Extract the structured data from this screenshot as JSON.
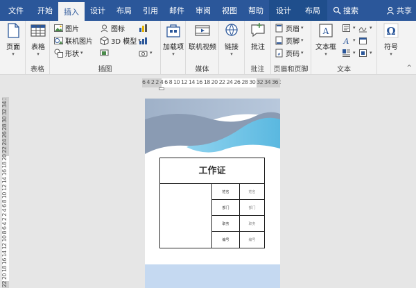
{
  "tabs": [
    {
      "label": "文件",
      "active": false
    },
    {
      "label": "开始",
      "active": false
    },
    {
      "label": "插入",
      "active": true
    },
    {
      "label": "设计",
      "active": false
    },
    {
      "label": "布局",
      "active": false
    },
    {
      "label": "引用",
      "active": false
    },
    {
      "label": "邮件",
      "active": false
    },
    {
      "label": "审阅",
      "active": false
    },
    {
      "label": "视图",
      "active": false
    },
    {
      "label": "帮助",
      "active": false
    },
    {
      "label": "设计",
      "active": false,
      "context": true
    },
    {
      "label": "布局",
      "active": false,
      "context": true
    }
  ],
  "search_label": "搜索",
  "share_label": "共享",
  "ribbon": {
    "page": {
      "button": "页面"
    },
    "table": {
      "button": "表格",
      "group": "表格"
    },
    "illustrations": {
      "group": "插图",
      "picture": "图片",
      "online_picture": "联机图片",
      "shapes": "形状",
      "icons": "图标",
      "model3d": "3D 模型"
    },
    "addins": {
      "button": "加载项"
    },
    "media": {
      "button": "联机视频",
      "group": "媒体"
    },
    "links": {
      "button": "链接"
    },
    "comments": {
      "button": "批注",
      "group": "批注"
    },
    "header_footer": {
      "header": "页眉",
      "footer": "页脚",
      "page_number": "页码",
      "group": "页眉和页脚"
    },
    "text": {
      "textbox": "文本框",
      "group": "文本"
    },
    "symbols": {
      "button": "符号"
    }
  },
  "ruler": {
    "corner": "∟",
    "horizontal": "6 4 2 2 4 6 8 10 12 14 16 18 20 22 24 26 28 30 32 34 36 38 40 42",
    "vertical": "22 20 18 16 14 12 10 8 6 4 2 2 4 6 8 10 12 14 16 18 20 22 24 26 28 30 32 34 36"
  },
  "document": {
    "card_title": "工作证",
    "labels": [
      "姓名",
      "部门",
      "职务",
      "编号"
    ],
    "values": [
      "姓名",
      "部门",
      "职务",
      "编号"
    ]
  },
  "colors": {
    "accent": "#2b579a",
    "wave_blue": "#6fc3e3",
    "wave_grey": "#8fa3bf",
    "footer_band": "#c5d9f1"
  }
}
